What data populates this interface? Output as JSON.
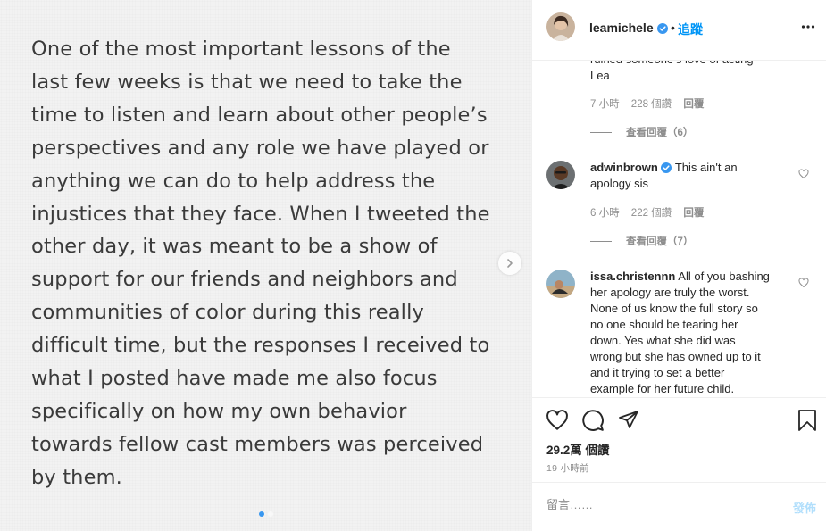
{
  "post": {
    "text_lines": [
      "One of the most important lessons of the",
      "last few weeks is that we need to take the",
      "time to listen and learn about other people’s",
      "perspectives and any role we have played or",
      "anything we can do to help address the",
      "injustices that they face. When I tweeted the",
      "other day, it was meant to be a show of",
      "support for our friends and neighbors and",
      "communities of color during this really",
      "difficult time, but the responses I received to",
      "what I posted have made me also focus",
      "specifically on how my own behavior",
      "towards fellow cast members was perceived",
      "by them."
    ]
  },
  "header": {
    "username": "leamichele",
    "separator": "•",
    "follow_label": "追蹤"
  },
  "comments": {
    "partial": {
      "line1": "ruined someone’s love of acting",
      "line2": "Lea",
      "time": "7 小時",
      "likes": "228 個讚",
      "reply": "回覆",
      "view_replies": "查看回覆（6）"
    },
    "items": [
      {
        "username": "adwinbrown",
        "text_line1": "This ain't an",
        "text_line2": "apology sis",
        "time": "6 小時",
        "likes": "222 個讚",
        "reply": "回覆",
        "view_replies": "查看回覆（7）"
      },
      {
        "username": "issa.christennn",
        "lines": [
          "All of you bashing",
          "her apology are truly the worst.",
          "None of us know the full story so",
          "no one should be tearing her",
          "down. Yes what she did was",
          "wrong but she has owned up to it",
          "and it trying to set a better",
          "example for her future child."
        ]
      }
    ]
  },
  "actions": {
    "likes": "29.2萬 個讚",
    "time_ago": "19 小時前"
  },
  "comment_input": {
    "placeholder": "留言……",
    "post_label": "發佈"
  },
  "colors": {
    "accent": "#0095f6",
    "verified": "#3897f0",
    "muted": "#8e8e8e"
  },
  "icons": [
    "heart-icon",
    "comment-icon",
    "share-icon",
    "bookmark-icon",
    "more-icon",
    "verified-icon",
    "chevron-right-icon"
  ]
}
